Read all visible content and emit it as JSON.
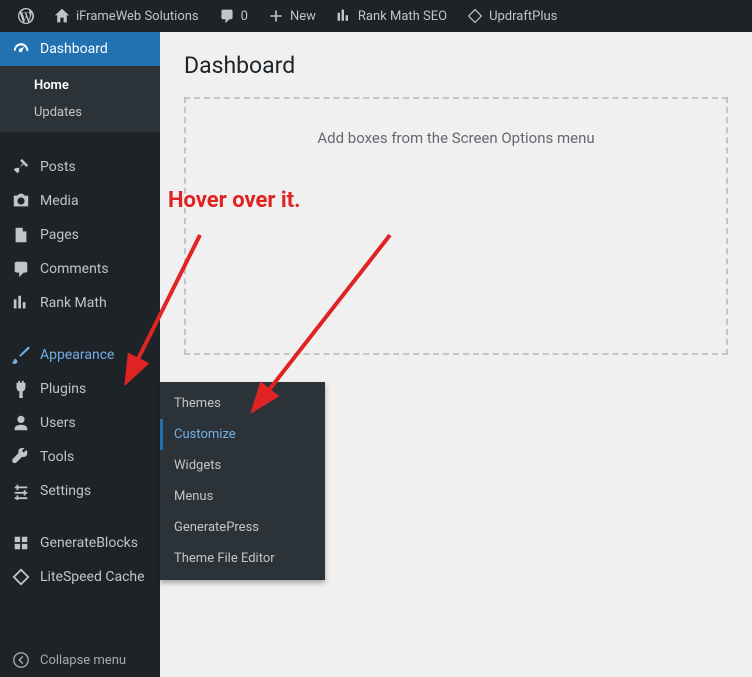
{
  "adminbar": {
    "site_name": "iFrameWeb Solutions",
    "comments_count": "0",
    "new_label": "New",
    "rankmath_label": "Rank Math SEO",
    "updraft_label": "UpdraftPlus"
  },
  "sidebar": {
    "dashboard": "Dashboard",
    "home": "Home",
    "updates": "Updates",
    "posts": "Posts",
    "media": "Media",
    "pages": "Pages",
    "comments": "Comments",
    "rankmath": "Rank Math",
    "appearance": "Appearance",
    "plugins": "Plugins",
    "users": "Users",
    "tools": "Tools",
    "settings": "Settings",
    "generateblocks": "GenerateBlocks",
    "litespeed": "LiteSpeed Cache",
    "collapse": "Collapse menu"
  },
  "flyout": {
    "themes": "Themes",
    "customize": "Customize",
    "widgets": "Widgets",
    "menus": "Menus",
    "generatepress": "GeneratePress",
    "theme_file_editor": "Theme File Editor"
  },
  "content": {
    "title": "Dashboard",
    "empty_box": "Add boxes from the Screen Options menu"
  },
  "annotation": {
    "text": "Hover over it."
  }
}
